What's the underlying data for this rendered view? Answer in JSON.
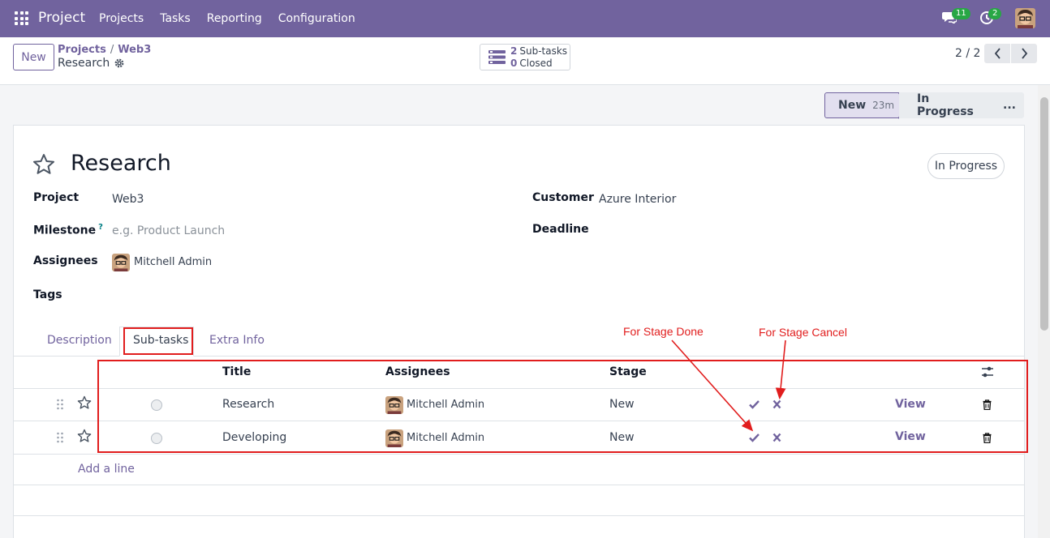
{
  "navbar": {
    "app_name": "Project",
    "menu": [
      "Projects",
      "Tasks",
      "Reporting",
      "Configuration"
    ],
    "chat_count": "11",
    "activity_count": "2"
  },
  "control": {
    "new_label": "New",
    "breadcrumb": [
      "Projects",
      "Web3"
    ],
    "breadcrumb_sep": "/",
    "current": "Research",
    "subtasks_count": "2",
    "subtasks_label": "Sub-tasks",
    "closed_count": "0",
    "closed_label": "Closed",
    "pager": "2 / 2"
  },
  "statusbar": {
    "stages": [
      "New",
      "In Progress",
      "..."
    ],
    "new_duration": "23m"
  },
  "form": {
    "title": "Research",
    "status_pill": "In Progress",
    "labels": {
      "project": "Project",
      "milestone": "Milestone",
      "milestone_help": "?",
      "assignees": "Assignees",
      "tags": "Tags",
      "customer": "Customer",
      "deadline": "Deadline"
    },
    "project": "Web3",
    "milestone_placeholder": "e.g. Product Launch",
    "assignee": "Mitchell Admin",
    "customer": "Azure Interior"
  },
  "tabs": [
    "Description",
    "Sub-tasks",
    "Extra Info"
  ],
  "table": {
    "headers": [
      "Title",
      "Assignees",
      "Stage"
    ],
    "rows": [
      {
        "title": "Research",
        "assignee": "Mitchell Admin",
        "stage": "New",
        "view": "View"
      },
      {
        "title": "Developing",
        "assignee": "Mitchell Admin",
        "stage": "New",
        "view": "View"
      }
    ],
    "add_line": "Add a line"
  },
  "annotations": {
    "done": "For Stage Done",
    "cancel": "For Stage Cancel"
  },
  "colors": {
    "brand": "#71639e",
    "annotation": "#e11d1d",
    "badge": "#28a745"
  }
}
